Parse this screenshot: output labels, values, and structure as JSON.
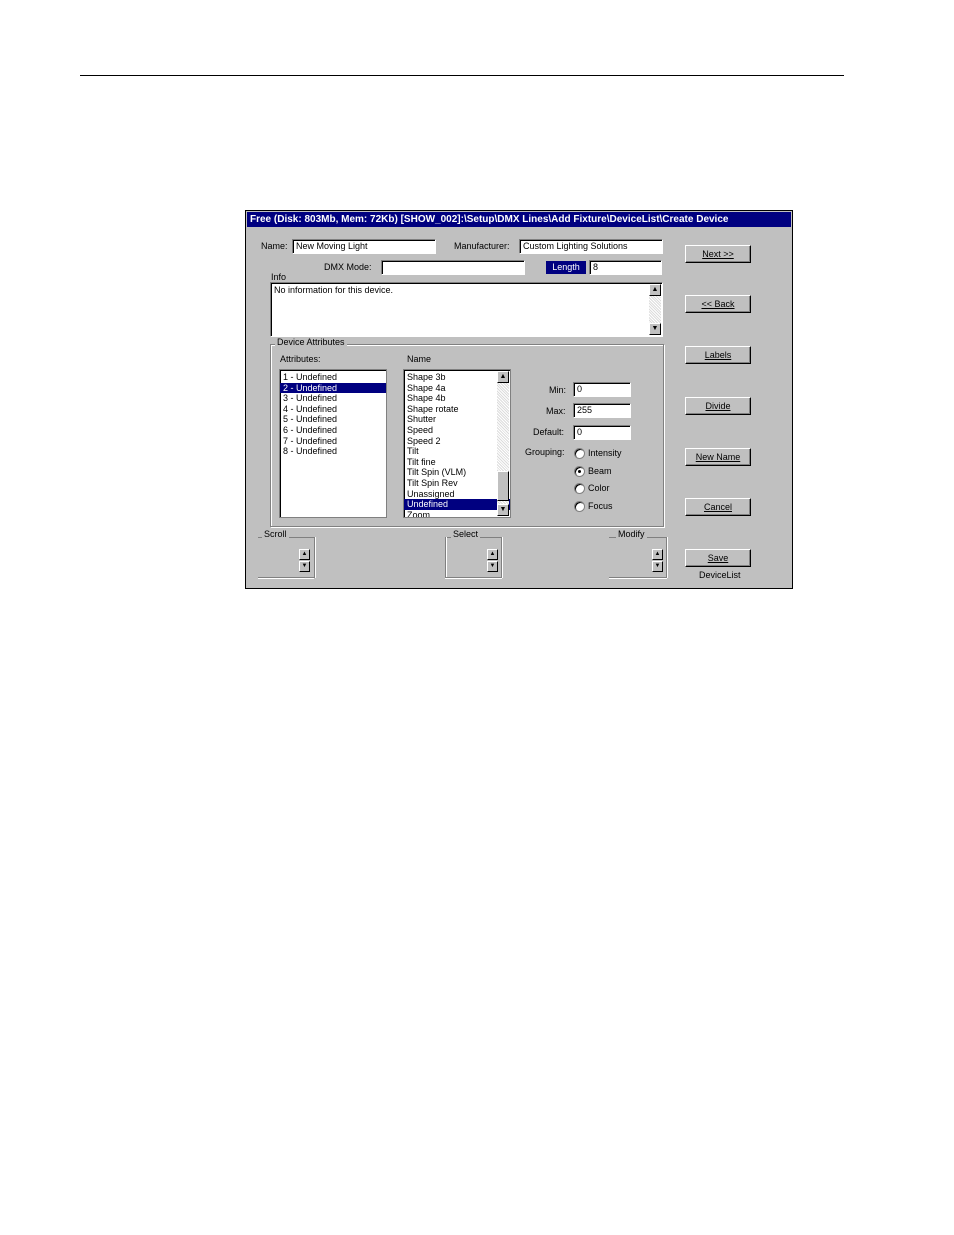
{
  "window": {
    "title": "Free (Disk: 803Mb, Mem: 72Kb)     [SHOW_002]:\\Setup\\DMX Lines\\Add Fixture\\DeviceList\\Create Device"
  },
  "form": {
    "name_label": "Name:",
    "name_value": "New Moving Light",
    "manufacturer_label": "Manufacturer:",
    "manufacturer_value": "Custom Lighting Solutions",
    "dmx_mode_label": "DMX Mode:",
    "dmx_mode_value": "",
    "length_label": "Length",
    "length_value": "8",
    "info_label": "Info",
    "info_value": "No information for this device."
  },
  "attributes_group": {
    "title": "Device Attributes",
    "attributes_label": "Attributes:",
    "attributes": [
      {
        "label": "1 - Undefined",
        "selected": false
      },
      {
        "label": "2 - Undefined",
        "selected": true
      },
      {
        "label": "3 - Undefined",
        "selected": false
      },
      {
        "label": "4 - Undefined",
        "selected": false
      },
      {
        "label": "5 - Undefined",
        "selected": false
      },
      {
        "label": "6 - Undefined",
        "selected": false
      },
      {
        "label": "7 - Undefined",
        "selected": false
      },
      {
        "label": "8 - Undefined",
        "selected": false
      }
    ],
    "name_label": "Name",
    "names": [
      {
        "label": "Shape 3b",
        "selected": false
      },
      {
        "label": "Shape 4a",
        "selected": false
      },
      {
        "label": "Shape 4b",
        "selected": false
      },
      {
        "label": "Shape rotate",
        "selected": false
      },
      {
        "label": "Shutter",
        "selected": false
      },
      {
        "label": "Speed",
        "selected": false
      },
      {
        "label": "Speed 2",
        "selected": false
      },
      {
        "label": "Tilt",
        "selected": false
      },
      {
        "label": "Tilt fine",
        "selected": false
      },
      {
        "label": "Tilt Spin (VLM)",
        "selected": false
      },
      {
        "label": "Tilt Spin Rev",
        "selected": false
      },
      {
        "label": "Unassigned",
        "selected": false
      },
      {
        "label": "Undefined",
        "selected": true
      },
      {
        "label": "Zoom",
        "selected": false
      }
    ],
    "min_label": "Min:",
    "min_value": "0",
    "max_label": "Max:",
    "max_value": "255",
    "default_label": "Default:",
    "default_value": "0",
    "grouping_label": "Grouping:",
    "grouping_options": [
      "Intensity",
      "Beam",
      "Color",
      "Focus"
    ],
    "grouping_selected": "Beam"
  },
  "bottom_bar": {
    "scroll_label": "Scroll",
    "select_label": "Select",
    "modify_label": "Modify"
  },
  "buttons": {
    "next": "Next >>",
    "back": "<< Back",
    "labels": "Labels",
    "divide": "Divide",
    "new_name": "New Name",
    "cancel": "Cancel",
    "save": "Save",
    "device_list_caption": "DeviceList"
  }
}
